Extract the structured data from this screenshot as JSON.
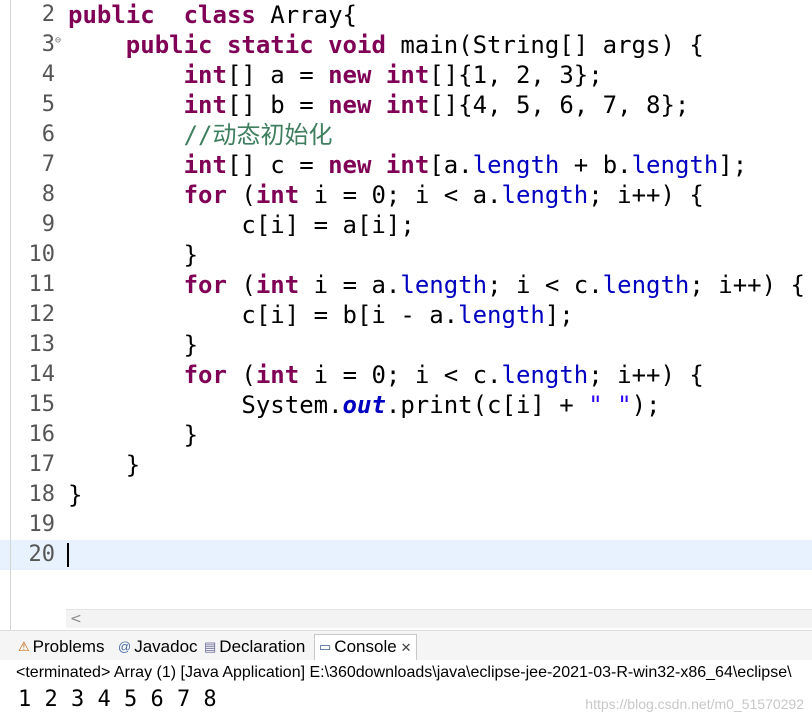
{
  "editor": {
    "lines": [
      {
        "n": "2",
        "tokens": [
          [
            "kw",
            "public"
          ],
          [
            "",
            "  "
          ],
          [
            "kw",
            "class"
          ],
          [
            "",
            " Array{"
          ]
        ]
      },
      {
        "n": "3",
        "fold": true,
        "tokens": [
          [
            "",
            "    "
          ],
          [
            "kw",
            "public"
          ],
          [
            "",
            " "
          ],
          [
            "kw",
            "static"
          ],
          [
            "",
            " "
          ],
          [
            "kw",
            "void"
          ],
          [
            "",
            " main(String[] args) {"
          ]
        ]
      },
      {
        "n": "4",
        "tokens": [
          [
            "",
            "        "
          ],
          [
            "kw",
            "int"
          ],
          [
            "",
            "[] a = "
          ],
          [
            "kw",
            "new"
          ],
          [
            "",
            " "
          ],
          [
            "kw",
            "int"
          ],
          [
            "",
            "[]{1, 2, 3};"
          ]
        ]
      },
      {
        "n": "5",
        "tokens": [
          [
            "",
            "        "
          ],
          [
            "kw",
            "int"
          ],
          [
            "",
            "[] b = "
          ],
          [
            "kw",
            "new"
          ],
          [
            "",
            " "
          ],
          [
            "kw",
            "int"
          ],
          [
            "",
            "[]{4, 5, 6, 7, 8};"
          ]
        ]
      },
      {
        "n": "6",
        "tokens": [
          [
            "",
            "        "
          ],
          [
            "cm",
            "//动态初始化"
          ]
        ]
      },
      {
        "n": "7",
        "tokens": [
          [
            "",
            "        "
          ],
          [
            "kw",
            "int"
          ],
          [
            "",
            "[] c = "
          ],
          [
            "kw",
            "new"
          ],
          [
            "",
            " "
          ],
          [
            "kw",
            "int"
          ],
          [
            "",
            "[a."
          ],
          [
            "fld",
            "length"
          ],
          [
            "",
            " + b."
          ],
          [
            "fld",
            "length"
          ],
          [
            "",
            "];"
          ]
        ]
      },
      {
        "n": "8",
        "tokens": [
          [
            "",
            "        "
          ],
          [
            "kw",
            "for"
          ],
          [
            "",
            " ("
          ],
          [
            "kw",
            "int"
          ],
          [
            "",
            " i = 0; i < a."
          ],
          [
            "fld",
            "length"
          ],
          [
            "",
            "; i++) {"
          ]
        ]
      },
      {
        "n": "9",
        "tokens": [
          [
            "",
            "            c[i] = a[i];"
          ]
        ]
      },
      {
        "n": "10",
        "tokens": [
          [
            "",
            "        }"
          ]
        ]
      },
      {
        "n": "11",
        "tokens": [
          [
            "",
            "        "
          ],
          [
            "kw",
            "for"
          ],
          [
            "",
            " ("
          ],
          [
            "kw",
            "int"
          ],
          [
            "",
            " i = a."
          ],
          [
            "fld",
            "length"
          ],
          [
            "",
            "; i < c."
          ],
          [
            "fld",
            "length"
          ],
          [
            "",
            "; i++) {"
          ]
        ]
      },
      {
        "n": "12",
        "tokens": [
          [
            "",
            "            c[i] = b[i - a."
          ],
          [
            "fld",
            "length"
          ],
          [
            "",
            "];"
          ]
        ]
      },
      {
        "n": "13",
        "tokens": [
          [
            "",
            "        }"
          ]
        ]
      },
      {
        "n": "14",
        "tokens": [
          [
            "",
            "        "
          ],
          [
            "kw",
            "for"
          ],
          [
            "",
            " ("
          ],
          [
            "kw",
            "int"
          ],
          [
            "",
            " i = 0; i < c."
          ],
          [
            "fld",
            "length"
          ],
          [
            "",
            "; i++) {"
          ]
        ]
      },
      {
        "n": "15",
        "tokens": [
          [
            "",
            "            System."
          ],
          [
            "st",
            "out"
          ],
          [
            "",
            ".print(c[i] + "
          ],
          [
            "str",
            "\" \""
          ],
          [
            "",
            ");"
          ]
        ]
      },
      {
        "n": "16",
        "tokens": [
          [
            "",
            "        }"
          ]
        ]
      },
      {
        "n": "17",
        "tokens": [
          [
            "",
            "    }"
          ]
        ]
      },
      {
        "n": "18",
        "tokens": [
          [
            "",
            "}"
          ]
        ]
      },
      {
        "n": "19",
        "tokens": []
      },
      {
        "n": "20",
        "current": true,
        "tokens": []
      }
    ]
  },
  "scroll_left_arrow": "<",
  "tabs": [
    {
      "label": "Problems",
      "icon": "problems-icon",
      "glyph": "⚠",
      "active": false
    },
    {
      "label": "Javadoc",
      "icon": "javadoc-icon",
      "glyph": "@",
      "active": false
    },
    {
      "label": "Declaration",
      "icon": "declaration-icon",
      "glyph": "▤",
      "active": false
    },
    {
      "label": "Console",
      "icon": "console-icon",
      "glyph": "▭",
      "active": true,
      "close": "✕"
    }
  ],
  "console": {
    "status": "<terminated> Array (1) [Java Application] E:\\360downloads\\java\\eclipse-jee-2021-03-R-win32-x86_64\\eclipse\\",
    "output": "1 2 3 4 5 6 7 8"
  },
  "watermark": "https://blog.csdn.net/m0_51570292",
  "colors": {
    "keyword": "#7f0055",
    "comment": "#3f7f5f",
    "field": "#0000c0",
    "string": "#2a00ff",
    "current_line": "#e8f2fe"
  }
}
